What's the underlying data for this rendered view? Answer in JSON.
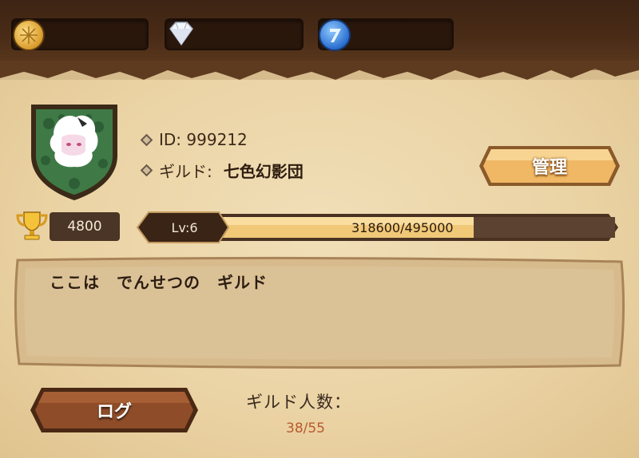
{
  "resources": [
    {
      "name": "gold-coin",
      "value": ""
    },
    {
      "name": "diamond",
      "value": ""
    },
    {
      "name": "blue-token",
      "value": ""
    }
  ],
  "guild": {
    "id_label": "ID: 999212",
    "guild_label": "ギルド: ",
    "guild_name": "七色幻影団",
    "trophies": "4800",
    "level": "Lv:6",
    "xp": "318600/495000",
    "xp_progress": 0.6436,
    "description": "ここは　でんせつの　ギルド",
    "member_label": "ギルド人数：",
    "member_count": "38/55"
  },
  "buttons": {
    "manage": "管理",
    "log": "ログ"
  },
  "colors": {
    "topbar": "#3d2414",
    "parchment": "#ead2a3",
    "xp_fill": "#f0c878",
    "member_count": "#b85a2e"
  }
}
